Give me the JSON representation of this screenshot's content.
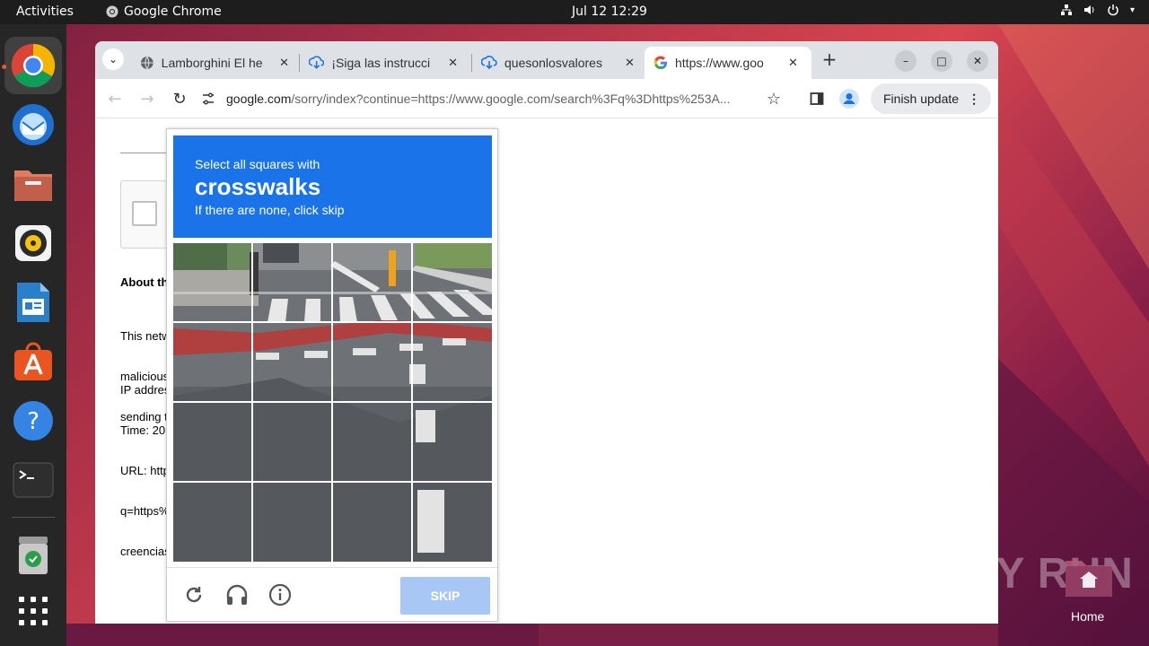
{
  "topbar": {
    "activities": "Activities",
    "app_name": "Google Chrome",
    "clock": "Jul 12  12:29"
  },
  "dock": {
    "items": [
      "chrome-icon",
      "thunderbird-icon",
      "files-icon",
      "rhythmbox-icon",
      "writer-icon",
      "software-icon",
      "help-icon",
      "terminal-icon",
      "trash-icon",
      "apps-grid-icon"
    ]
  },
  "tabs": [
    {
      "title": "Lamborghini El he",
      "icon": "globe-icon"
    },
    {
      "title": "¡Siga las instrucci",
      "icon": "cloud-download-icon"
    },
    {
      "title": "quesonlosvalores",
      "icon": "cloud-download-icon"
    },
    {
      "title": "https://www.goo",
      "icon": "google-icon"
    }
  ],
  "toolbar": {
    "url_host": "google.com",
    "url_rest": "/sorry/index?continue=https://www.google.com/search%3Fq%3Dhttps%253A...",
    "finish_update": "Finish update"
  },
  "page": {
    "about": "About th",
    "para1": [
      "This netw",
      "malicious",
      "sending t"
    ],
    "para2": [
      "IP addres",
      "Time: 20",
      "URL: http",
      "q=https%",
      "creencias"
    ]
  },
  "captcha": {
    "line1": "Select all squares with",
    "keyword": "crosswalks",
    "line3": "If there are none, click skip",
    "skip": "SKIP",
    "colors": {
      "header": "#1a73e8",
      "skip_disabled": "#a9c7f5"
    }
  },
  "desktop": {
    "home_label": "Home",
    "watermark": "ANY RUN"
  }
}
